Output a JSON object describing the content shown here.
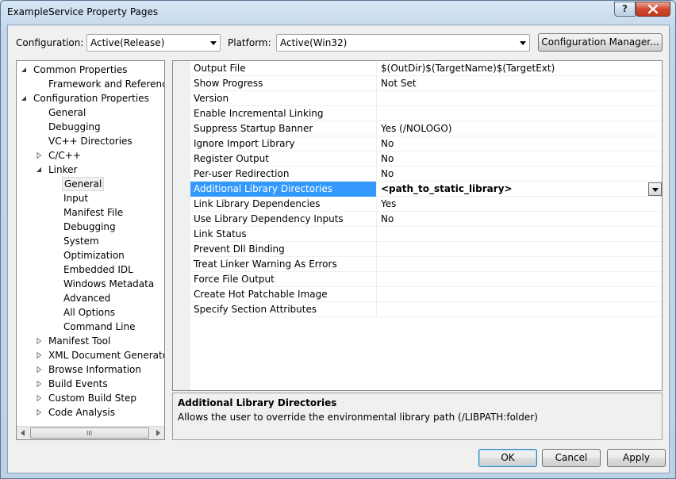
{
  "window": {
    "title": "ExampleService Property Pages",
    "help_label": "?",
    "close_icon": "close-icon"
  },
  "config_bar": {
    "configuration_label": "Configuration:",
    "configuration_value": "Active(Release)",
    "platform_label": "Platform:",
    "platform_value": "Active(Win32)",
    "config_manager_label": "Configuration Manager..."
  },
  "tree": {
    "items": [
      {
        "label": "Common Properties",
        "level": 0,
        "expander": "expanded"
      },
      {
        "label": "Framework and References",
        "level": 1,
        "expander": "none"
      },
      {
        "label": "Configuration Properties",
        "level": 0,
        "expander": "expanded"
      },
      {
        "label": "General",
        "level": 1,
        "expander": "none"
      },
      {
        "label": "Debugging",
        "level": 1,
        "expander": "none"
      },
      {
        "label": "VC++ Directories",
        "level": 1,
        "expander": "none"
      },
      {
        "label": "C/C++",
        "level": 1,
        "expander": "collapsed"
      },
      {
        "label": "Linker",
        "level": 1,
        "expander": "expanded"
      },
      {
        "label": "General",
        "level": 2,
        "expander": "none",
        "selected": true
      },
      {
        "label": "Input",
        "level": 2,
        "expander": "none"
      },
      {
        "label": "Manifest File",
        "level": 2,
        "expander": "none"
      },
      {
        "label": "Debugging",
        "level": 2,
        "expander": "none"
      },
      {
        "label": "System",
        "level": 2,
        "expander": "none"
      },
      {
        "label": "Optimization",
        "level": 2,
        "expander": "none"
      },
      {
        "label": "Embedded IDL",
        "level": 2,
        "expander": "none"
      },
      {
        "label": "Windows Metadata",
        "level": 2,
        "expander": "none"
      },
      {
        "label": "Advanced",
        "level": 2,
        "expander": "none"
      },
      {
        "label": "All Options",
        "level": 2,
        "expander": "none"
      },
      {
        "label": "Command Line",
        "level": 2,
        "expander": "none"
      },
      {
        "label": "Manifest Tool",
        "level": 1,
        "expander": "collapsed"
      },
      {
        "label": "XML Document Generator",
        "level": 1,
        "expander": "collapsed"
      },
      {
        "label": "Browse Information",
        "level": 1,
        "expander": "collapsed"
      },
      {
        "label": "Build Events",
        "level": 1,
        "expander": "collapsed"
      },
      {
        "label": "Custom Build Step",
        "level": 1,
        "expander": "collapsed"
      },
      {
        "label": "Code Analysis",
        "level": 1,
        "expander": "collapsed"
      }
    ],
    "scroll_grip": "III"
  },
  "properties": {
    "rows": [
      {
        "name": "Output File",
        "value": "$(OutDir)$(TargetName)$(TargetExt)"
      },
      {
        "name": "Show Progress",
        "value": "Not Set"
      },
      {
        "name": "Version",
        "value": ""
      },
      {
        "name": "Enable Incremental Linking",
        "value": ""
      },
      {
        "name": "Suppress Startup Banner",
        "value": "Yes (/NOLOGO)"
      },
      {
        "name": "Ignore Import Library",
        "value": "No"
      },
      {
        "name": "Register Output",
        "value": "No"
      },
      {
        "name": "Per-user Redirection",
        "value": "No"
      },
      {
        "name": "Additional Library Directories",
        "value": "<path_to_static_library>",
        "selected": true
      },
      {
        "name": "Link Library Dependencies",
        "value": "Yes"
      },
      {
        "name": "Use Library Dependency Inputs",
        "value": "No"
      },
      {
        "name": "Link Status",
        "value": ""
      },
      {
        "name": "Prevent Dll Binding",
        "value": ""
      },
      {
        "name": "Treat Linker Warning As Errors",
        "value": ""
      },
      {
        "name": "Force File Output",
        "value": ""
      },
      {
        "name": "Create Hot Patchable Image",
        "value": ""
      },
      {
        "name": "Specify Section Attributes",
        "value": ""
      }
    ]
  },
  "description": {
    "title": "Additional Library Directories",
    "text": "Allows the user to override the environmental library path (/LIBPATH:folder)"
  },
  "footer": {
    "ok_label": "OK",
    "cancel_label": "Cancel",
    "apply_label": "Apply"
  },
  "colors": {
    "selection": "#3399ff",
    "window_frame": "#c9dcef",
    "client_bg": "#f0f0f0"
  }
}
